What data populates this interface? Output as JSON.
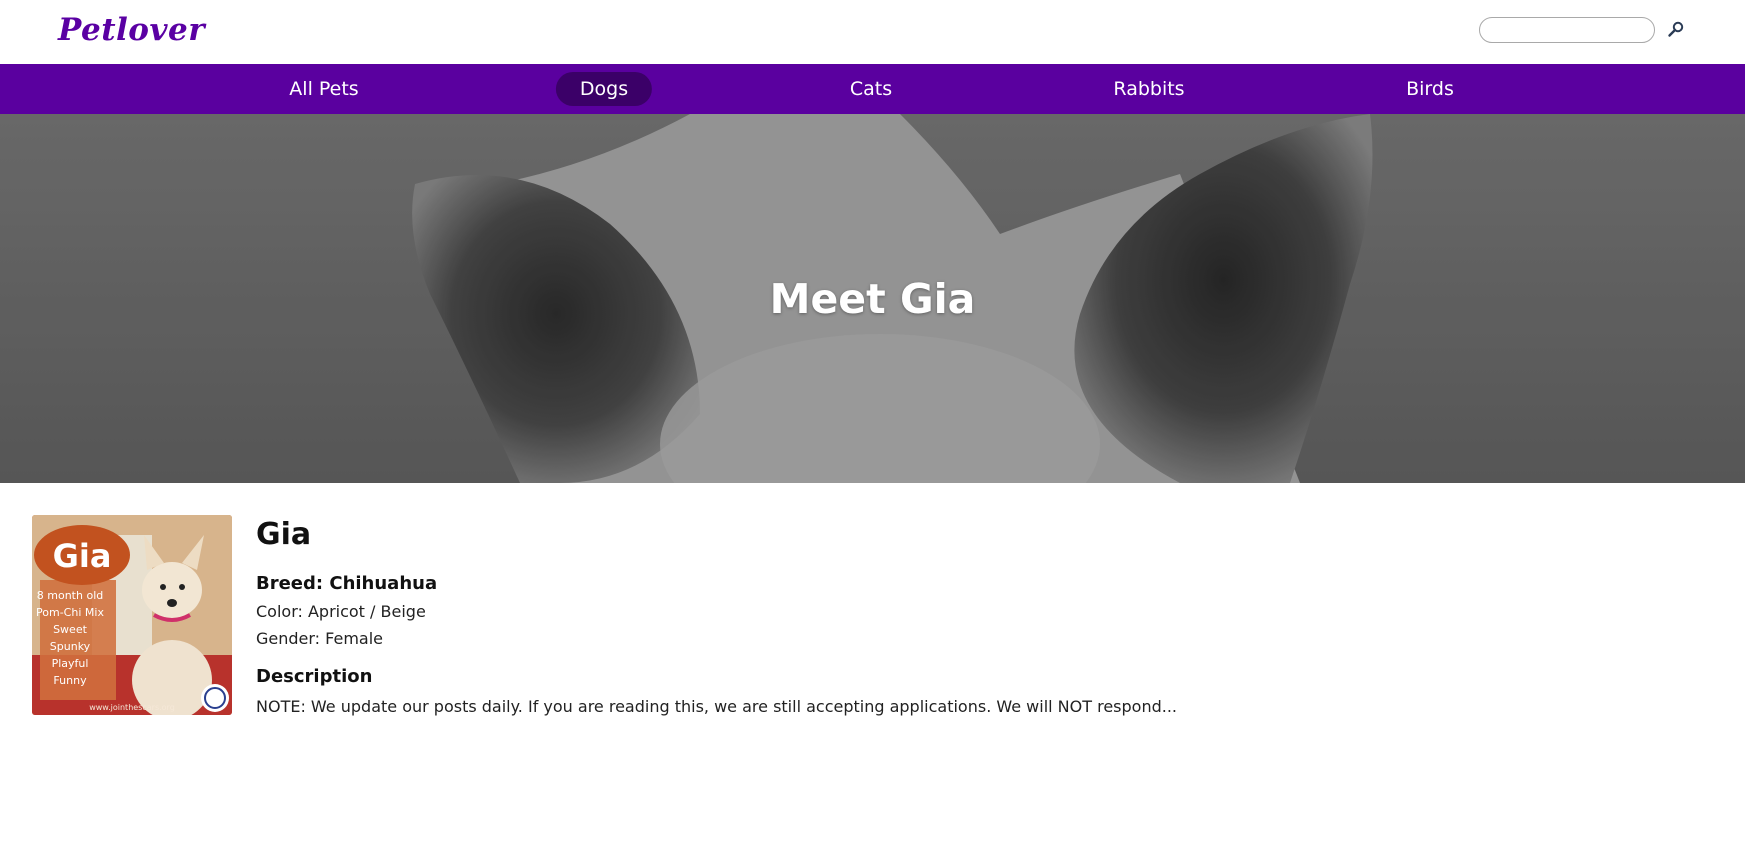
{
  "header": {
    "logo": "Petlover",
    "search": {
      "value": "",
      "placeholder": ""
    },
    "search_icon": "search-icon"
  },
  "nav": {
    "items": [
      {
        "label": "All Pets",
        "active": false
      },
      {
        "label": "Dogs",
        "active": true
      },
      {
        "label": "Cats",
        "active": false
      },
      {
        "label": "Rabbits",
        "active": false
      },
      {
        "label": "Birds",
        "active": false
      }
    ]
  },
  "hero": {
    "title": "Meet Gia"
  },
  "pet": {
    "name": "Gia",
    "breed": "Breed: Chihuahua",
    "color": "Color: Apricot / Beige",
    "gender": "Gender: Female",
    "photo": {
      "name_text": "Gia",
      "lines": [
        "8 month old",
        "Pom-Chi Mix",
        "Sweet",
        "Spunky",
        "Playful",
        "Funny"
      ],
      "site": "www.jointhescars.org"
    }
  },
  "description": {
    "heading": "Description",
    "text": "NOTE: We update our posts daily. If you are reading this, we are still accepting applications. We will NOT respond..."
  },
  "colors": {
    "brand": "#5a009f",
    "nav_active": "#3b0068",
    "logo": "#5a00a3"
  }
}
